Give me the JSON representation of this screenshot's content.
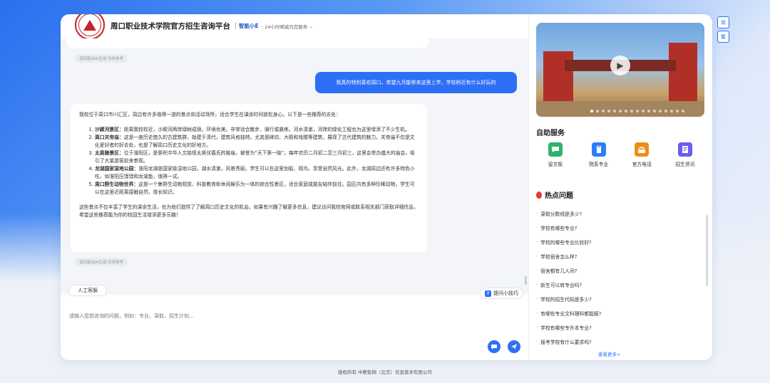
{
  "header": {
    "title": "周口职业技术学院官方招生咨询平台",
    "brand": "智能小E",
    "tagline": "· 24小时竭诚为您服务 ~"
  },
  "side_buttons": [
    "简",
    "繁"
  ],
  "chat": {
    "ai_note": "该回复由AI生成 仅供参考",
    "user_message": "我真的特别喜欢周口，希望九月能够来这里上学，学校附近有什么好玩的",
    "ai_intro": "我校位于周口市川汇区，周边有许多值得一游的景点和活动场所，适合学生在课余时间放松身心。以下是一些推荐的去处：",
    "ai_items": [
      {
        "name": "沙颍河景区：",
        "text": "距离我校较近，沙颍河两岸绿树成荫，环境优美。非常适合散步、骑行或晨练。河水清澈，河岸的绿化工程也为这里增添了不少生机。"
      },
      {
        "name": "周口关帝庙：",
        "text": "这是一座历史悠久的古建筑群，始建于清代，建筑风格独特，尤其是碑坊、大殿和戏楼等建筑，展现了古代建筑的魅力。关帝庙不仅是文化爱好者的好去处，也是了解周口历史文化的好地方。"
      },
      {
        "name": "太昊陵景区：",
        "text": "位于淮阳区，是祭祀中华人文始祖太昊伏羲氏的陵庙，被誉为“天下第一陵”。每年农历二月初二至三月初三，这里会举办盛大的庙会，吸引了大量游客前来参观。"
      },
      {
        "name": "龙湖国家湿地公园：",
        "text": "淮阳龙湖是国家级湿地公园，湖水清澈，风景秀丽。学生可以在这里划船、观鸟，享受自然风光。此外，龙湖周边还有许多特色小吃，如淮阳压馍馍和龙湖鱼，值得一试。"
      },
      {
        "name": "周口野生动物世界：",
        "text": "这是一个集野生动物观赏、科普教育和休闲娱乐为一体的综合性景区，适合家庭或朋友结伴前往。园区内有多种珍稀动物，学生可以在这里近距离接触自然，增长知识。"
      }
    ],
    "ai_outro": "这些景点不仅丰富了学生的课余生活，也为他们提供了了解周口历史文化的机会。如果有兴趣了解更多信息，建议访问我校官网或联系相关部门获取详细信息。希望这些推荐能为你的校园生活增添更多乐趣！",
    "human_button": "人工客服",
    "tips_button": "提问小技巧",
    "input_placeholder": "请输入您想咨询的问题，例如：专业、录取、招生计划..."
  },
  "services": {
    "title": "自助服务",
    "items": [
      {
        "label": "留言板",
        "icon": "chat-icon",
        "color": "#2db36a"
      },
      {
        "label": "院系专业",
        "icon": "book-icon",
        "color": "#2d7ff7"
      },
      {
        "label": "官方电话",
        "icon": "phone-icon",
        "color": "#f08c1a"
      },
      {
        "label": "招生资讯",
        "icon": "document-icon",
        "color": "#6a5cf0"
      }
    ]
  },
  "hot": {
    "title": "热点问题",
    "items": [
      "录取分数线是多少?",
      "学校有哪些专业?",
      "学校的哪些专业比较好?",
      "学校宿舍怎么样?",
      "宿舍都有几人间?",
      "新生可以转专业吗?",
      "学校的招生代码是多少?",
      "有哪些专业文科理科都能报?",
      "学校有哪些专升本专业?",
      "报考学校有什么要求吗?"
    ],
    "more": "查看更多>"
  },
  "footer": "版权所有 中教智网（北京）信息技术有限公司",
  "colors": {
    "primary": "#2d6ff7",
    "hot": "#e53935"
  }
}
